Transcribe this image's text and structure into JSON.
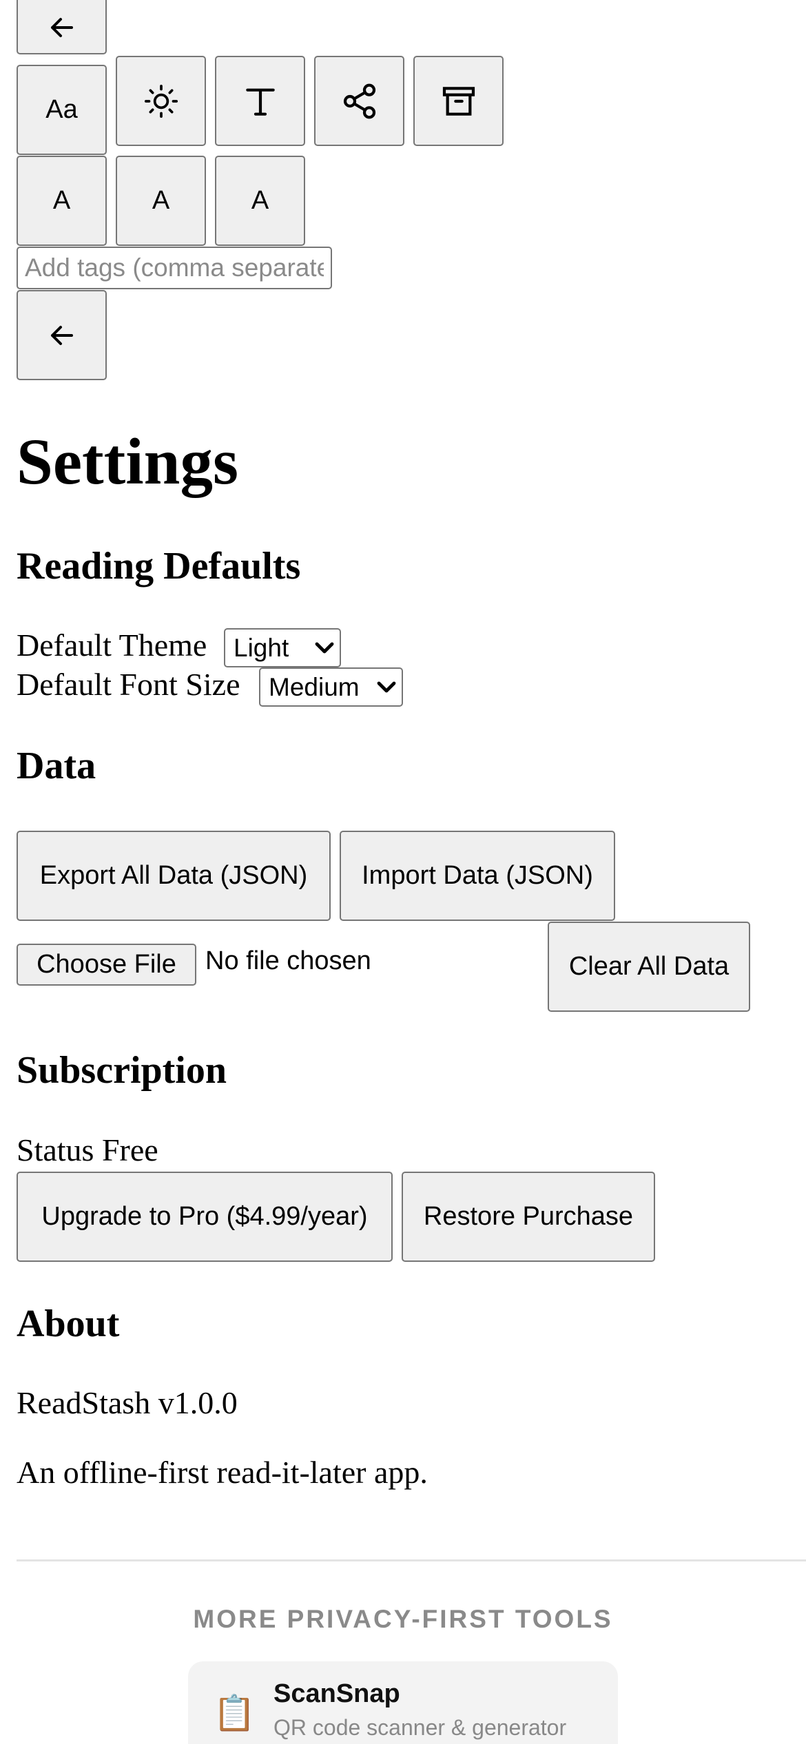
{
  "reader_toolbar": {
    "font_button_label": "Aa",
    "size_buttons": [
      "A",
      "A",
      "A"
    ],
    "tags_placeholder": "Add tags (comma separated)"
  },
  "icons": {
    "back": "arrow-left-icon",
    "font": "font-icon",
    "theme": "sun-icon",
    "typography": "text-t-icon",
    "share": "share-icon",
    "archive": "archive-icon",
    "dropdown": "chevron-down-icon",
    "tool": "clipboard-icon"
  },
  "settings": {
    "title": "Settings",
    "reading_defaults": {
      "heading": "Reading Defaults",
      "theme_label": "Default Theme",
      "theme_value": "Light",
      "font_size_label": "Default Font Size",
      "font_size_value": "Medium"
    },
    "data": {
      "heading": "Data",
      "export_label": "Export All Data (JSON)",
      "import_label": "Import Data (JSON)",
      "choose_file_label": "Choose File",
      "no_file_label": "No file chosen",
      "clear_label": "Clear All Data"
    },
    "subscription": {
      "heading": "Subscription",
      "status_label": "Status",
      "status_value": "Free",
      "upgrade_label": "Upgrade to Pro ($4.99/year)",
      "restore_label": "Restore Purchase"
    },
    "about": {
      "heading": "About",
      "version": "ReadStash v1.0.0",
      "description": "An offline-first read-it-later app."
    }
  },
  "more_tools": {
    "heading": "MORE PRIVACY-FIRST TOOLS",
    "items": [
      {
        "name": "ScanSnap",
        "description": "QR code scanner & generator"
      }
    ]
  },
  "colors": {
    "button_bg": "#efefef",
    "button_border": "#767676",
    "muted_text": "#8a8a8a",
    "card_bg": "#f3f3f3"
  }
}
